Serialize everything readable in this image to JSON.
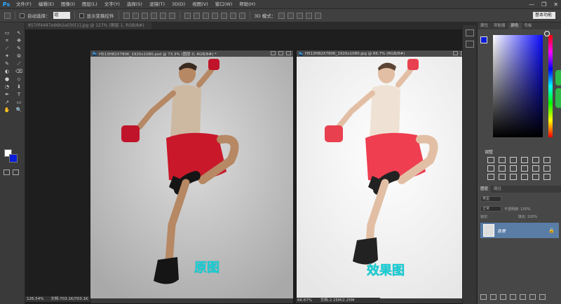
{
  "app": {
    "logo": "Ps"
  },
  "menu": [
    "文件(F)",
    "编辑(E)",
    "图像(I)",
    "图层(L)",
    "文字(Y)",
    "选择(S)",
    "滤镜(T)",
    "3D(D)",
    "视图(V)",
    "窗口(W)",
    "帮助(H)"
  ],
  "window_controls": {
    "minimize": "—",
    "restore": "❐",
    "close": "✕"
  },
  "options": {
    "auto_select_label": "自动选择：",
    "auto_select_value": "组",
    "show_transform_label": "显示变换控件",
    "mode3d_label": "3D 模式：",
    "workspace_value": "基本功能"
  },
  "background_tab": {
    "label": "8570f4487e66b2a030[1].jpg @ 127% (图层 1, RGB/8#)"
  },
  "tools": [
    "▭",
    "↖",
    "⌗",
    "✥",
    "⟋",
    "✎",
    "✦",
    "⦾",
    "✎",
    "⟋",
    "◐",
    "⌫",
    "●",
    "⬦",
    "◔",
    "⬇",
    "✒",
    "T",
    "↗",
    "▭",
    "✋",
    "🔍"
  ],
  "doc_left": {
    "title": "H513H82X780K_1920x1080.psd @ 73.3% (图层 0, RGB/8#) *",
    "zoom": "126.54%",
    "doc_size": "文档:703.1K/703.1K",
    "caption": "原图"
  },
  "doc_right": {
    "title": "H513H82X780K_1920x1080.jpg @ 66.7% (RGB/8#)",
    "zoom": "66.67%",
    "doc_size": "文档:2.25M/2.25M",
    "caption": "效果图"
  },
  "panels": {
    "top_tabs": [
      "属性",
      "导航器",
      "颜色",
      "色板"
    ],
    "active_top_tab": "颜色",
    "adjustments_title": "调整",
    "layers_tabs": [
      "图层",
      "路径"
    ],
    "kind_select": "类型",
    "blend_select": "正常",
    "opacity_label": "不透明度: 100%",
    "lock_label": "锁定:",
    "fill_label": "填充: 100%",
    "layer_name": "背景",
    "lock_glyph": "🔒"
  },
  "colors": {
    "foreground": "#ffffff",
    "background": "#0b1cd8",
    "caption": "#19cfd6",
    "accent_layer": "#5a7da6"
  }
}
